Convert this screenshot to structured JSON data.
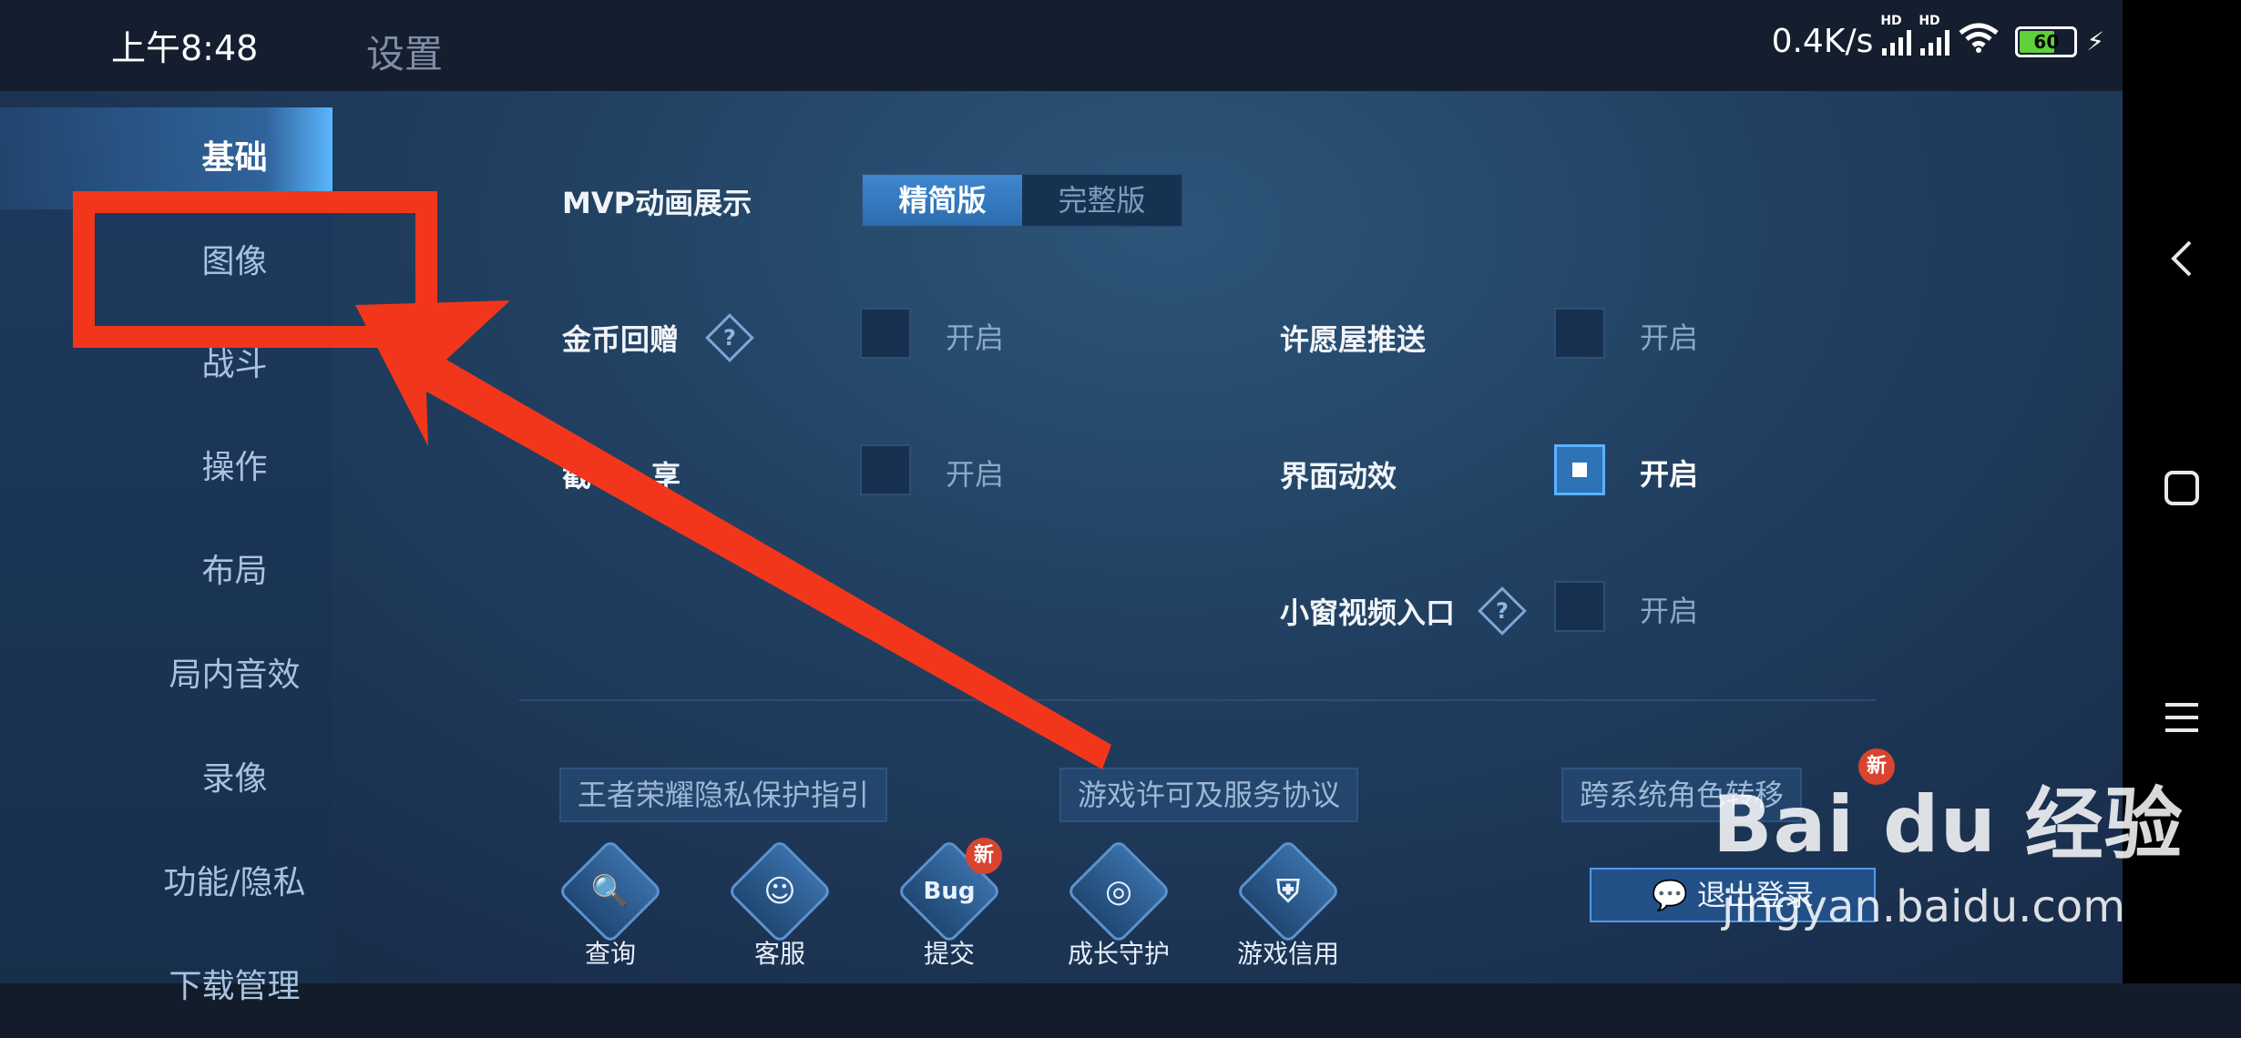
{
  "status_bar": {
    "time": "上午8:48",
    "title": "设置",
    "net_speed": "0.4K/s",
    "sim1_tag": "HD",
    "sim2_tag": "HD",
    "battery": "60"
  },
  "sidebar": {
    "items": [
      {
        "label": "基础"
      },
      {
        "label": "图像"
      },
      {
        "label": "战斗"
      },
      {
        "label": "操作"
      },
      {
        "label": "布局"
      },
      {
        "label": "局内音效"
      },
      {
        "label": "录像"
      },
      {
        "label": "功能/隐私"
      },
      {
        "label": "下载管理"
      }
    ]
  },
  "settings": {
    "mvp_label": "MVP动画展示",
    "mvp_options": [
      "精简版",
      "完整版"
    ],
    "mvp_selected": "精简版",
    "coin_label": "金币回赠",
    "coin_toggle": "开启",
    "wish_label": "许愿屋推送",
    "wish_toggle": "开启",
    "screenshot_label_visible": "截",
    "screenshot_label_tail": "享",
    "screenshot_toggle": "开启",
    "ui_anim_label": "界面动效",
    "ui_anim_toggle": "开启",
    "mini_video_label": "小窗视频入口",
    "mini_video_toggle": "开启",
    "help_glyph": "?"
  },
  "links": {
    "privacy": "王者荣耀隐私保护指引",
    "license": "游戏许可及服务协议",
    "transfer": "跨系统角色转移",
    "new_badge": "新"
  },
  "bottom_icons": [
    {
      "label": "查询",
      "glyph": "🔍"
    },
    {
      "label": "客服",
      "glyph": "☺"
    },
    {
      "label": "提交",
      "glyph": "Bug"
    },
    {
      "label": "成长守护",
      "glyph": "◎"
    },
    {
      "label": "游戏信用",
      "glyph": "⛨"
    }
  ],
  "logout_label": "退出登录",
  "watermark": {
    "brand": "Bai du 经验",
    "url": "jingyan.baidu.com"
  }
}
